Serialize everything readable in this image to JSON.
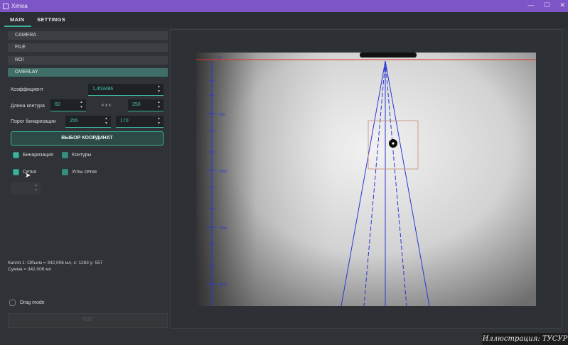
{
  "window": {
    "title": "Ximea"
  },
  "tabs": [
    {
      "label": "MAIN"
    },
    {
      "label": "SETTINGS"
    }
  ],
  "sections": [
    {
      "label": "CAMERA"
    },
    {
      "label": "FILE"
    },
    {
      "label": "ROI"
    },
    {
      "label": "OVERLAY"
    }
  ],
  "overlay": {
    "coef_label": "Коэффициент",
    "coef_value": "1,453486",
    "contour_label": "Длина контура",
    "contour_min": "60",
    "contour_sep": "< x <",
    "contour_max": "250",
    "bin_label": "Порог бинаризации",
    "bin_min": "255",
    "bin_max": "170",
    "coords_button": "ВЫБОР КООРДИНАТ",
    "checks": [
      {
        "label": "Бинаризация",
        "checked": true
      },
      {
        "label": "Контуры",
        "checked": true
      },
      {
        "label": "Сетка",
        "checked": true
      },
      {
        "label": "Углы сетки",
        "checked": true
      }
    ]
  },
  "info": {
    "line1": "Капля 1: Объем = 342,006 мл, x: 1283 y: 557",
    "line2": "Сумма = 342,006 мл"
  },
  "drag_mode_label": "Drag mode",
  "test_button": "TEST",
  "viewer": {
    "ruler_labels": [
      "0",
      "500",
      "1000",
      "1500",
      "2000"
    ]
  },
  "watermark": "Иллюстрация: ТУСУР",
  "colors": {
    "accent": "#3bb39c",
    "titlebar": "#7d55c7",
    "overlay_lines": "#2a35d6",
    "red_line": "#e03030"
  }
}
